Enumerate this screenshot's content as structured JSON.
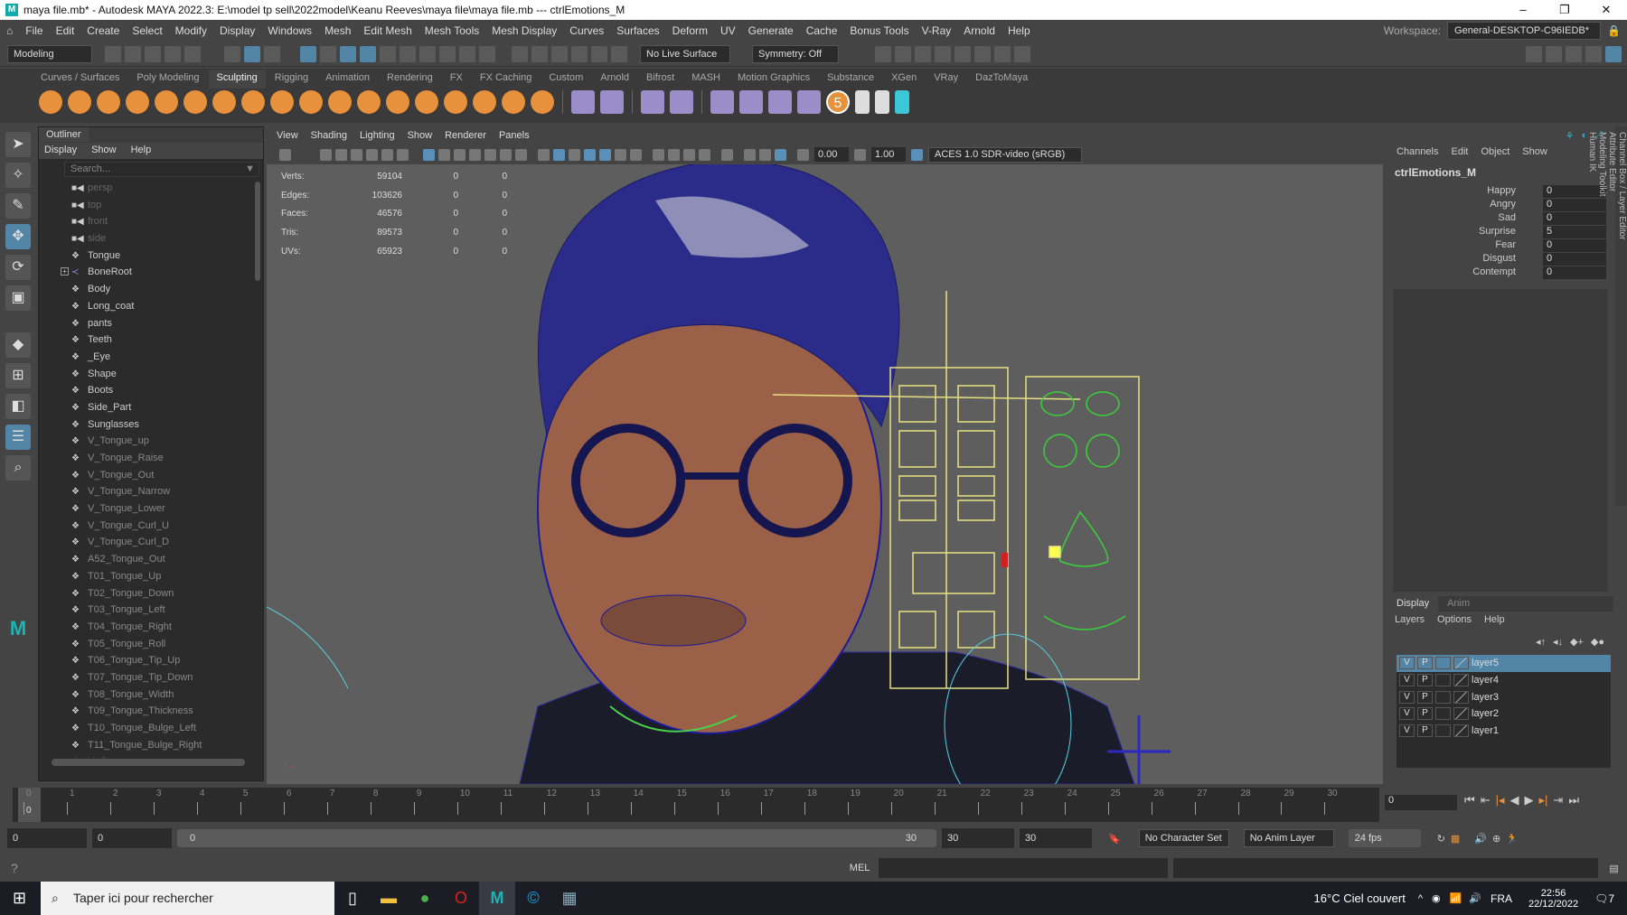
{
  "title": "maya file.mb* - Autodesk MAYA 2022.3: E:\\model tp sell\\2022model\\Keanu Reeves\\maya file\\maya file.mb  ---  ctrlEmotions_M",
  "window_controls": {
    "minimize": "–",
    "maximize": "❐",
    "close": "✕"
  },
  "menu": [
    "File",
    "Edit",
    "Create",
    "Select",
    "Modify",
    "Display",
    "Windows",
    "Mesh",
    "Edit Mesh",
    "Mesh Tools",
    "Mesh Display",
    "Curves",
    "Surfaces",
    "Deform",
    "UV",
    "Generate",
    "Cache",
    "Bonus Tools",
    "V-Ray",
    "Arnold",
    "Help"
  ],
  "workspace": {
    "label": "Workspace:",
    "value": "General-DESKTOP-C96IEDB*"
  },
  "status": {
    "mode": "Modeling",
    "live_surface": "No Live Surface",
    "symmetry": "Symmetry: Off"
  },
  "shelf_tabs": [
    "Curves / Surfaces",
    "Poly Modeling",
    "Sculpting",
    "Rigging",
    "Animation",
    "Rendering",
    "FX",
    "FX Caching",
    "Custom",
    "Arnold",
    "Bifrost",
    "MASH",
    "Motion Graphics",
    "Substance",
    "XGen",
    "VRay",
    "DazToMaya"
  ],
  "shelf_active": "Sculpting",
  "shelf_badge": "5",
  "outliner": {
    "title": "Outliner",
    "menu": [
      "Display",
      "Show",
      "Help"
    ],
    "search_placeholder": "Search...",
    "items": [
      {
        "name": "persp",
        "type": "camera"
      },
      {
        "name": "top",
        "type": "camera"
      },
      {
        "name": "front",
        "type": "camera"
      },
      {
        "name": "side",
        "type": "camera"
      },
      {
        "name": "Tongue",
        "type": "mesh"
      },
      {
        "name": "BoneRoot",
        "type": "joint",
        "expand": "+"
      },
      {
        "name": "Body",
        "type": "mesh"
      },
      {
        "name": "Long_coat",
        "type": "mesh"
      },
      {
        "name": "pants",
        "type": "mesh"
      },
      {
        "name": "Teeth",
        "type": "mesh"
      },
      {
        "name": "_Eye",
        "type": "mesh"
      },
      {
        "name": "Shape",
        "type": "mesh"
      },
      {
        "name": "Boots",
        "type": "mesh"
      },
      {
        "name": "Side_Part",
        "type": "mesh"
      },
      {
        "name": "Sunglasses",
        "type": "mesh"
      },
      {
        "name": "V_Tongue_up",
        "type": "hidden"
      },
      {
        "name": "V_Tongue_Raise",
        "type": "hidden"
      },
      {
        "name": "V_Tongue_Out",
        "type": "hidden"
      },
      {
        "name": "V_Tongue_Narrow",
        "type": "hidden"
      },
      {
        "name": "V_Tongue_Lower",
        "type": "hidden"
      },
      {
        "name": "V_Tongue_Curl_U",
        "type": "hidden"
      },
      {
        "name": "V_Tongue_Curl_D",
        "type": "hidden"
      },
      {
        "name": "A52_Tongue_Out",
        "type": "hidden"
      },
      {
        "name": "T01_Tongue_Up",
        "type": "hidden"
      },
      {
        "name": "T02_Tongue_Down",
        "type": "hidden"
      },
      {
        "name": "T03_Tongue_Left",
        "type": "hidden"
      },
      {
        "name": "T04_Tongue_Right",
        "type": "hidden"
      },
      {
        "name": "T05_Tongue_Roll",
        "type": "hidden"
      },
      {
        "name": "T06_Tongue_Tip_Up",
        "type": "hidden"
      },
      {
        "name": "T07_Tongue_Tip_Down",
        "type": "hidden"
      },
      {
        "name": "T08_Tongue_Width",
        "type": "hidden"
      },
      {
        "name": "T09_Tongue_Thickness",
        "type": "hidden"
      },
      {
        "name": "T10_Tongue_Bulge_Left",
        "type": "hidden"
      },
      {
        "name": "T11_Tongue_Bulge_Right",
        "type": "hidden"
      },
      {
        "name": "V_Open",
        "type": "hidden"
      }
    ]
  },
  "viewport": {
    "menu": [
      "View",
      "Shading",
      "Lighting",
      "Show",
      "Renderer",
      "Panels"
    ],
    "exposure": "0.00",
    "gamma": "1.00",
    "color_space": "ACES 1.0 SDR-video (sRGB)",
    "stats": [
      {
        "label": "Verts:",
        "v": "59104",
        "a": "0",
        "b": "0"
      },
      {
        "label": "Edges:",
        "v": "103626",
        "a": "0",
        "b": "0"
      },
      {
        "label": "Faces:",
        "v": "46576",
        "a": "0",
        "b": "0"
      },
      {
        "label": "Tris:",
        "v": "89573",
        "a": "0",
        "b": "0"
      },
      {
        "label": "UVs:",
        "v": "65923",
        "a": "0",
        "b": "0"
      }
    ]
  },
  "channel_box": {
    "menu": [
      "Channels",
      "Edit",
      "Object",
      "Show"
    ],
    "object": "ctrlEmotions_M",
    "channels": [
      {
        "name": "Happy",
        "value": "0"
      },
      {
        "name": "Angry",
        "value": "0"
      },
      {
        "name": "Sad",
        "value": "0"
      },
      {
        "name": "Surprise",
        "value": "5"
      },
      {
        "name": "Fear",
        "value": "0"
      },
      {
        "name": "Disgust",
        "value": "0"
      },
      {
        "name": "Contempt",
        "value": "0"
      }
    ]
  },
  "side_tabs": [
    "Channel Box / Layer Editor",
    "Attribute Editor",
    "Modeling Toolkit",
    "Human IK"
  ],
  "layer_editor": {
    "tabs": [
      "Display",
      "Anim"
    ],
    "menu": [
      "Layers",
      "Options",
      "Help"
    ],
    "layers": [
      {
        "v": "V",
        "p": "P",
        "name": "layer5",
        "selected": true
      },
      {
        "v": "V",
        "p": "P",
        "name": "layer4"
      },
      {
        "v": "V",
        "p": "P",
        "name": "layer3"
      },
      {
        "v": "V",
        "p": "P",
        "name": "layer2"
      },
      {
        "v": "V",
        "p": "P",
        "name": "layer1"
      }
    ]
  },
  "timeline": {
    "ticks": [
      "0",
      "1",
      "2",
      "3",
      "4",
      "5",
      "6",
      "7",
      "8",
      "9",
      "10",
      "11",
      "12",
      "13",
      "14",
      "15",
      "16",
      "17",
      "18",
      "19",
      "20",
      "21",
      "22",
      "23",
      "24",
      "25",
      "26",
      "27",
      "28",
      "29",
      "30"
    ],
    "current": "0",
    "current_field": "0"
  },
  "range": {
    "start": "0",
    "anim_start": "0",
    "slider_start": "0",
    "slider_end": "30",
    "end": "30",
    "anim_end": "30",
    "character_set": "No Character Set",
    "anim_layer": "No Anim Layer",
    "fps": "24 fps"
  },
  "command": {
    "lang": "MEL"
  },
  "taskbar": {
    "search": "Taper ici pour rechercher",
    "weather": "16°C  Ciel couvert",
    "lang": "FRA",
    "time": "22:56",
    "date": "22/12/2022",
    "notif": "7"
  },
  "colors": {
    "accent": "#5285a6",
    "shelf_orange": "#e8913c",
    "rig_yellow": "#e8e080",
    "wire_blue": "#1a1a9a"
  }
}
